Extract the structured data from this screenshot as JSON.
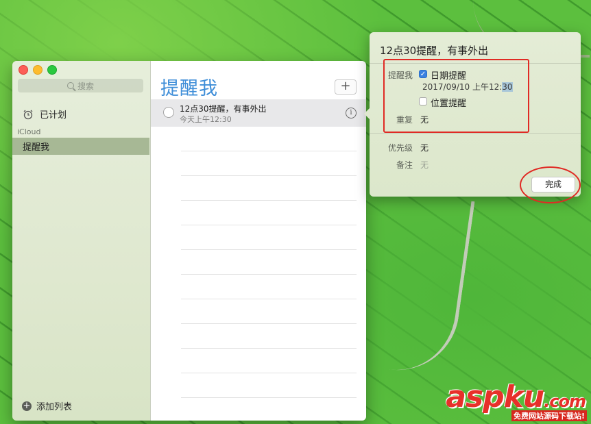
{
  "sidebar": {
    "search_placeholder": "搜索",
    "scheduled_label": "已计划",
    "section_header": "iCloud",
    "lists": [
      {
        "label": "提醒我"
      }
    ],
    "add_list_label": "添加列表"
  },
  "main": {
    "list_title": "提醒我",
    "add_button": "+",
    "items": [
      {
        "title": "12点30提醒，有事外出",
        "due": "今天上午12:30",
        "info": "i"
      }
    ]
  },
  "popover": {
    "title": "12点30提醒，有事外出",
    "remind_label": "提醒我",
    "date_check_label": "日期提醒",
    "date_checked": true,
    "date_value": "2017/09/10  上午12:",
    "time_selected": "30",
    "location_check_label": "位置提醒",
    "location_checked": false,
    "repeat_label": "重复",
    "repeat_value": "无",
    "priority_label": "优先级",
    "priority_value": "无",
    "notes_label": "备注",
    "notes_value": "无",
    "done_label": "完成"
  },
  "watermark": {
    "brand": "aspku",
    "suffix": ".com",
    "tagline": "免费网站源码下载站!"
  },
  "colors": {
    "accent_blue": "#3f8ed8",
    "selection_green": "#a7b895",
    "annotation_red": "#e02a24"
  },
  "icons": [
    "search-icon",
    "alarm-clock-icon",
    "plus-icon",
    "info-icon",
    "checkmark-icon"
  ]
}
